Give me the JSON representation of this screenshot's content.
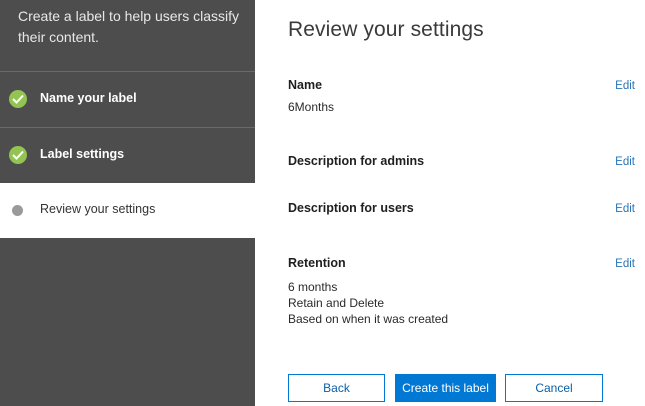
{
  "sidebar": {
    "header": "Create a label to help users classify their content.",
    "steps": [
      {
        "label": "Name your label",
        "status": "completed",
        "icon": "checkmark-icon"
      },
      {
        "label": "Label settings",
        "status": "completed",
        "icon": "checkmark-icon"
      },
      {
        "label": "Review your settings",
        "status": "current",
        "icon": "dot-icon"
      }
    ]
  },
  "main": {
    "title": "Review your settings",
    "sections": {
      "name": {
        "heading": "Name",
        "edit": "Edit",
        "value": "6Months"
      },
      "admin_description": {
        "heading": "Description for admins",
        "edit": "Edit"
      },
      "user_description": {
        "heading": "Description for users",
        "edit": "Edit"
      },
      "retention": {
        "heading": "Retention",
        "edit": "Edit",
        "lines": [
          "6 months",
          "Retain and Delete",
          "Based on when it was created"
        ]
      }
    }
  },
  "footer": {
    "back_label": "Back",
    "create_label": "Create this label",
    "cancel_label": "Cancel"
  },
  "colors": {
    "sidebar_bg": "#4d4d4d",
    "check_green": "#92c353",
    "accent_blue": "#0078d4",
    "link_blue": "#2a74b8",
    "pending_dot": "#9a9a9a"
  }
}
